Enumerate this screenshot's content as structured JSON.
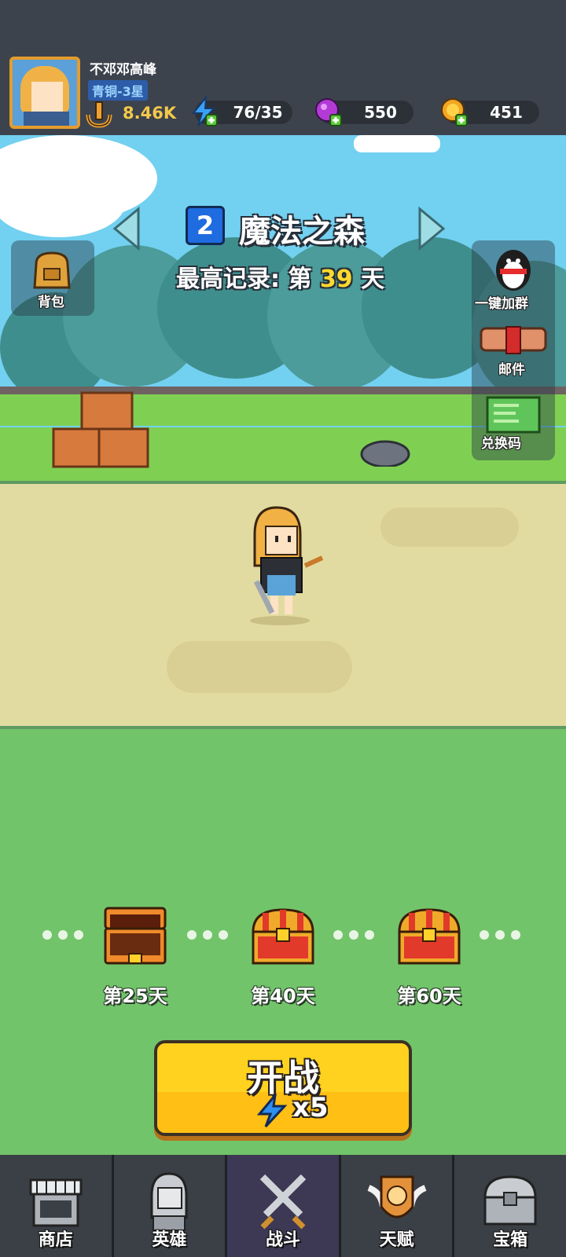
{
  "header": {
    "player_name": "不邓邓高峰",
    "rank": "青铜-3星",
    "power": "8.46K",
    "energy": "76/35",
    "gems": "550",
    "coins": "451"
  },
  "stage": {
    "number": "2",
    "name": "魔法之森",
    "record_prefix": "最高记录: 第",
    "record_day": "39",
    "record_suffix": "天"
  },
  "side_buttons": {
    "backpack": "背包",
    "join_group": "一键加群",
    "mail": "邮件",
    "redeem_code": "兑换码"
  },
  "rewards": [
    {
      "label": "第25天",
      "state": "opened"
    },
    {
      "label": "第40天",
      "state": "locked"
    },
    {
      "label": "第60天",
      "state": "locked"
    }
  ],
  "battle": {
    "label": "开战",
    "cost": "x5"
  },
  "nav": [
    {
      "label": "商店",
      "icon": "shop-icon"
    },
    {
      "label": "英雄",
      "icon": "hero-icon"
    },
    {
      "label": "战斗",
      "icon": "crossed-swords-icon",
      "active": true
    },
    {
      "label": "天赋",
      "icon": "talent-icon"
    },
    {
      "label": "宝箱",
      "icon": "treasure-chest-icon"
    }
  ],
  "colors": {
    "header_bg": "#3d434d",
    "accent_yellow": "#ffd21f",
    "field_green": "#72c46a",
    "path_sand": "#e2dba1"
  }
}
